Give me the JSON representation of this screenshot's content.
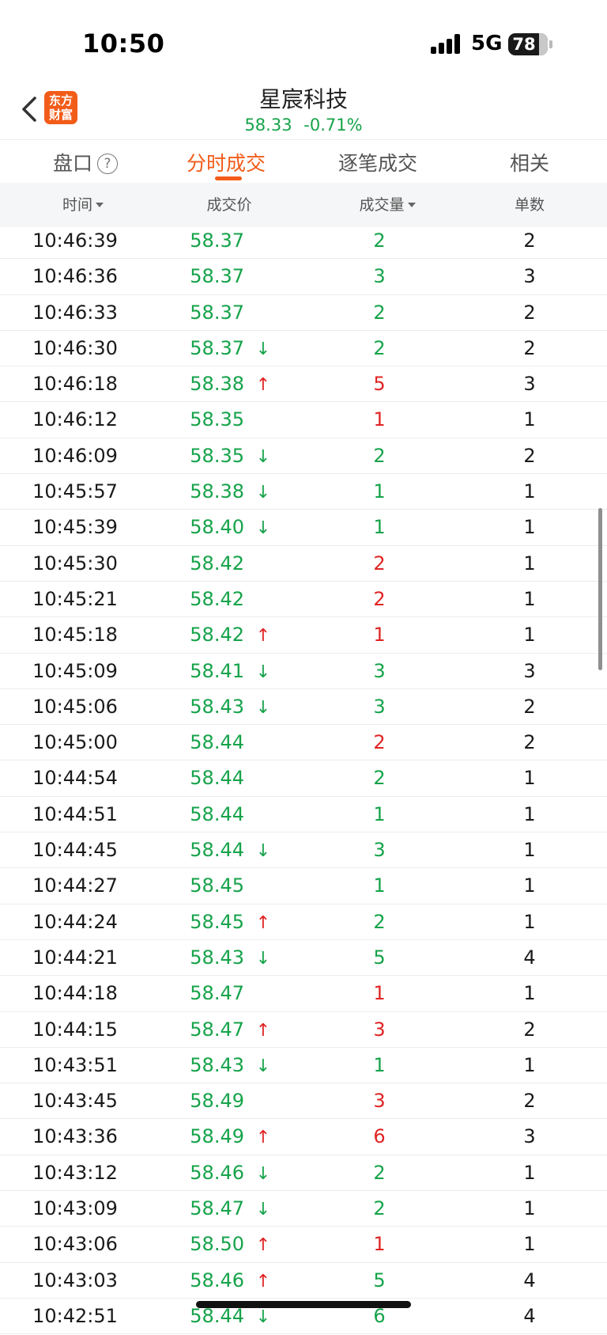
{
  "status_bar": {
    "time": "10:50",
    "network": "5G",
    "battery": "78",
    "battery_level": 78
  },
  "nav": {
    "logo_line1": "东方",
    "logo_line2": "财富",
    "title": "星宸科技",
    "price": "58.33",
    "change": "-0.71%"
  },
  "tabs": [
    {
      "label": "盘口",
      "help": "?"
    },
    {
      "label": "分时成交"
    },
    {
      "label": "逐笔成交"
    },
    {
      "label": "相关"
    }
  ],
  "columns": {
    "time": "时间",
    "price": "成交价",
    "volume": "成交量",
    "count": "单数"
  },
  "colors": {
    "accent": "#f25c19",
    "up": "#e02424",
    "down": "#16a34a"
  },
  "rows": [
    {
      "time": "10:46:39",
      "price": "58.37",
      "arrow": "",
      "volume": "2",
      "vol_color": "green",
      "count": "2"
    },
    {
      "time": "10:46:36",
      "price": "58.37",
      "arrow": "",
      "volume": "3",
      "vol_color": "green",
      "count": "3"
    },
    {
      "time": "10:46:33",
      "price": "58.37",
      "arrow": "",
      "volume": "2",
      "vol_color": "green",
      "count": "2"
    },
    {
      "time": "10:46:30",
      "price": "58.37",
      "arrow": "down",
      "volume": "2",
      "vol_color": "green",
      "count": "2"
    },
    {
      "time": "10:46:18",
      "price": "58.38",
      "arrow": "up",
      "volume": "5",
      "vol_color": "red",
      "count": "3"
    },
    {
      "time": "10:46:12",
      "price": "58.35",
      "arrow": "",
      "volume": "1",
      "vol_color": "red",
      "count": "1"
    },
    {
      "time": "10:46:09",
      "price": "58.35",
      "arrow": "down",
      "volume": "2",
      "vol_color": "green",
      "count": "2"
    },
    {
      "time": "10:45:57",
      "price": "58.38",
      "arrow": "down",
      "volume": "1",
      "vol_color": "green",
      "count": "1"
    },
    {
      "time": "10:45:39",
      "price": "58.40",
      "arrow": "down",
      "volume": "1",
      "vol_color": "green",
      "count": "1"
    },
    {
      "time": "10:45:30",
      "price": "58.42",
      "arrow": "",
      "volume": "2",
      "vol_color": "red",
      "count": "1"
    },
    {
      "time": "10:45:21",
      "price": "58.42",
      "arrow": "",
      "volume": "2",
      "vol_color": "red",
      "count": "1"
    },
    {
      "time": "10:45:18",
      "price": "58.42",
      "arrow": "up",
      "volume": "1",
      "vol_color": "red",
      "count": "1"
    },
    {
      "time": "10:45:09",
      "price": "58.41",
      "arrow": "down",
      "volume": "3",
      "vol_color": "green",
      "count": "3"
    },
    {
      "time": "10:45:06",
      "price": "58.43",
      "arrow": "down",
      "volume": "3",
      "vol_color": "green",
      "count": "2"
    },
    {
      "time": "10:45:00",
      "price": "58.44",
      "arrow": "",
      "volume": "2",
      "vol_color": "red",
      "count": "2"
    },
    {
      "time": "10:44:54",
      "price": "58.44",
      "arrow": "",
      "volume": "2",
      "vol_color": "green",
      "count": "1"
    },
    {
      "time": "10:44:51",
      "price": "58.44",
      "arrow": "",
      "volume": "1",
      "vol_color": "green",
      "count": "1"
    },
    {
      "time": "10:44:45",
      "price": "58.44",
      "arrow": "down",
      "volume": "3",
      "vol_color": "green",
      "count": "1"
    },
    {
      "time": "10:44:27",
      "price": "58.45",
      "arrow": "",
      "volume": "1",
      "vol_color": "green",
      "count": "1"
    },
    {
      "time": "10:44:24",
      "price": "58.45",
      "arrow": "up",
      "volume": "2",
      "vol_color": "green",
      "count": "1"
    },
    {
      "time": "10:44:21",
      "price": "58.43",
      "arrow": "down",
      "volume": "5",
      "vol_color": "green",
      "count": "4"
    },
    {
      "time": "10:44:18",
      "price": "58.47",
      "arrow": "",
      "volume": "1",
      "vol_color": "red",
      "count": "1"
    },
    {
      "time": "10:44:15",
      "price": "58.47",
      "arrow": "up",
      "volume": "3",
      "vol_color": "red",
      "count": "2"
    },
    {
      "time": "10:43:51",
      "price": "58.43",
      "arrow": "down",
      "volume": "1",
      "vol_color": "green",
      "count": "1"
    },
    {
      "time": "10:43:45",
      "price": "58.49",
      "arrow": "",
      "volume": "3",
      "vol_color": "red",
      "count": "2"
    },
    {
      "time": "10:43:36",
      "price": "58.49",
      "arrow": "up",
      "volume": "6",
      "vol_color": "red",
      "count": "3"
    },
    {
      "time": "10:43:12",
      "price": "58.46",
      "arrow": "down",
      "volume": "2",
      "vol_color": "green",
      "count": "1"
    },
    {
      "time": "10:43:09",
      "price": "58.47",
      "arrow": "down",
      "volume": "2",
      "vol_color": "green",
      "count": "1"
    },
    {
      "time": "10:43:06",
      "price": "58.50",
      "arrow": "up",
      "volume": "1",
      "vol_color": "red",
      "count": "1"
    },
    {
      "time": "10:43:03",
      "price": "58.46",
      "arrow": "up",
      "volume": "5",
      "vol_color": "green",
      "count": "4"
    },
    {
      "time": "10:42:51",
      "price": "58.44",
      "arrow": "down",
      "volume": "6",
      "vol_color": "green",
      "count": "4"
    }
  ]
}
